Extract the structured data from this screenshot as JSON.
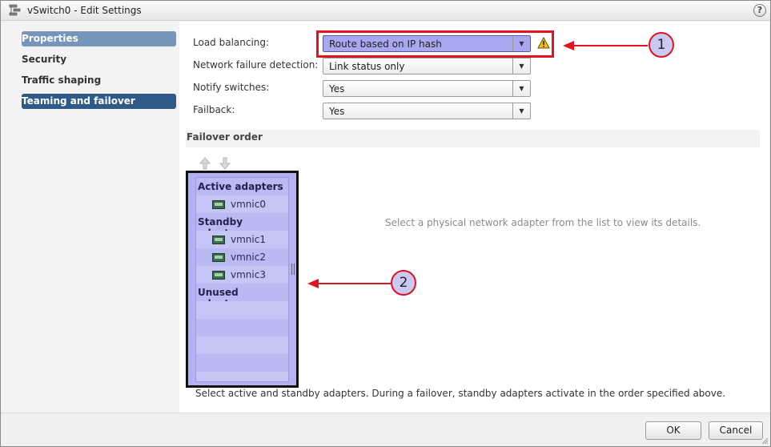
{
  "window": {
    "title": "vSwitch0 - Edit Settings",
    "help_label": "?"
  },
  "sidebar": {
    "items": [
      {
        "label": "Properties",
        "state": "hover"
      },
      {
        "label": "Security",
        "state": "normal"
      },
      {
        "label": "Traffic shaping",
        "state": "normal"
      },
      {
        "label": "Teaming and failover",
        "state": "selected"
      }
    ]
  },
  "form": {
    "load_balancing": {
      "label": "Load balancing:",
      "value": "Route based on IP hash"
    },
    "network_failure_detection": {
      "label": "Network failure detection:",
      "value": "Link status only"
    },
    "notify_switches": {
      "label": "Notify switches:",
      "value": "Yes"
    },
    "failback": {
      "label": "Failback:",
      "value": "Yes"
    }
  },
  "failover": {
    "header": "Failover order",
    "groups": {
      "active": "Active adapters",
      "standby": "Standby adapters",
      "unused": "Unused adapters"
    },
    "adapters": {
      "active": [
        "vmnic0"
      ],
      "standby": [
        "vmnic1",
        "vmnic2",
        "vmnic3"
      ],
      "unused": []
    },
    "details_hint": "Select a physical network adapter from the list to view its details.",
    "footer_note": "Select active and standby adapters. During a failover, standby adapters activate in the order specified above."
  },
  "buttons": {
    "ok": "OK",
    "cancel": "Cancel"
  },
  "callouts": {
    "one": "1",
    "two": "2"
  },
  "icons": {
    "title": "vswitch-icon",
    "warning": "warning-icon",
    "move_up": "arrow-up-icon",
    "move_down": "arrow-down-icon",
    "nic": "network-adapter-icon"
  },
  "colors": {
    "selected_nav": "#2f5a87",
    "hover_nav": "#7595bb",
    "callout_red": "#e0141e",
    "highlight_lavender": "#a8a8f0"
  }
}
